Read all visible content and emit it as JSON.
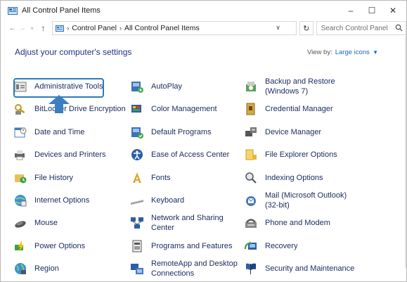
{
  "window": {
    "title": "All Control Panel Items",
    "controls": {
      "minimize": "–",
      "maximize": "☐",
      "close": "✕"
    }
  },
  "address": {
    "crumbs": [
      "Control Panel",
      "All Control Panel Items"
    ],
    "search_placeholder": "Search Control Panel"
  },
  "header": {
    "heading": "Adjust your computer's settings",
    "view_by_label": "View by:",
    "view_by_value": "Large icons"
  },
  "items": [
    {
      "label": "Administrative Tools",
      "icon": "admin-tools-icon"
    },
    {
      "label": "AutoPlay",
      "icon": "autoplay-icon"
    },
    {
      "label": "Backup and Restore\n(Windows 7)",
      "icon": "backup-icon"
    },
    {
      "label": "BitLocker Drive Encryption",
      "icon": "bitlocker-icon"
    },
    {
      "label": "Color Management",
      "icon": "color-management-icon"
    },
    {
      "label": "Credential Manager",
      "icon": "credential-manager-icon"
    },
    {
      "label": "Date and Time",
      "icon": "date-time-icon"
    },
    {
      "label": "Default Programs",
      "icon": "default-programs-icon"
    },
    {
      "label": "Device Manager",
      "icon": "device-manager-icon"
    },
    {
      "label": "Devices and Printers",
      "icon": "devices-printers-icon"
    },
    {
      "label": "Ease of Access Center",
      "icon": "ease-of-access-icon"
    },
    {
      "label": "File Explorer Options",
      "icon": "file-explorer-options-icon"
    },
    {
      "label": "File History",
      "icon": "file-history-icon"
    },
    {
      "label": "Fonts",
      "icon": "fonts-icon"
    },
    {
      "label": "Indexing Options",
      "icon": "indexing-options-icon"
    },
    {
      "label": "Internet Options",
      "icon": "internet-options-icon"
    },
    {
      "label": "Keyboard",
      "icon": "keyboard-icon"
    },
    {
      "label": "Mail (Microsoft Outlook)\n(32-bit)",
      "icon": "mail-icon"
    },
    {
      "label": "Mouse",
      "icon": "mouse-icon"
    },
    {
      "label": "Network and Sharing\nCenter",
      "icon": "network-sharing-icon"
    },
    {
      "label": "Phone and Modem",
      "icon": "phone-modem-icon"
    },
    {
      "label": "Power Options",
      "icon": "power-options-icon"
    },
    {
      "label": "Programs and Features",
      "icon": "programs-features-icon"
    },
    {
      "label": "Recovery",
      "icon": "recovery-icon"
    },
    {
      "label": "Region",
      "icon": "region-icon"
    },
    {
      "label": "RemoteApp and Desktop\nConnections",
      "icon": "remoteapp-icon"
    },
    {
      "label": "Security and Maintenance",
      "icon": "security-maintenance-icon"
    }
  ],
  "colors": {
    "heading": "#1e3287",
    "link": "#1e64c8",
    "highlight": "#2e7ab9"
  }
}
